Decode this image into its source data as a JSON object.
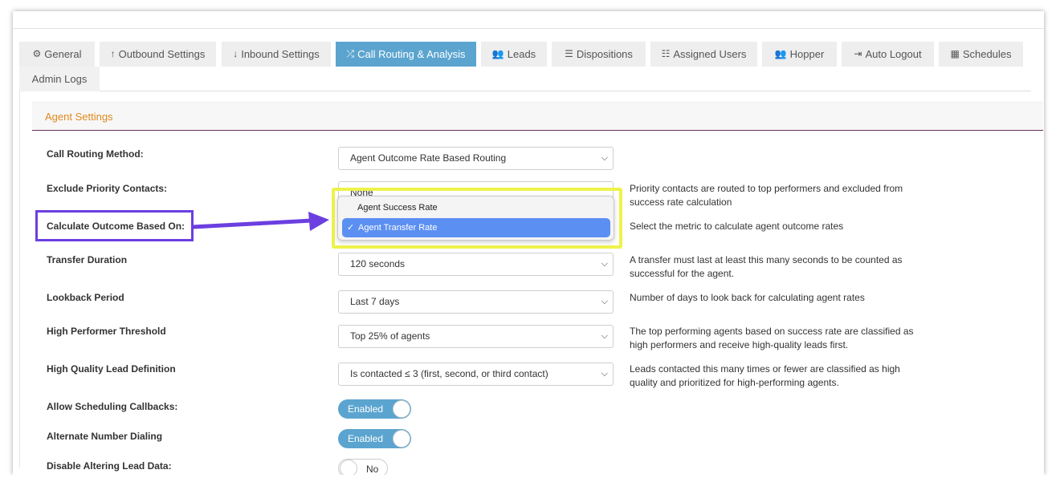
{
  "tabs": [
    {
      "label": "General",
      "icon": "gears-icon"
    },
    {
      "label": "Outbound Settings",
      "icon": "arrow-up-icon"
    },
    {
      "label": "Inbound Settings",
      "icon": "arrow-down-icon"
    },
    {
      "label": "Call Routing & Analysis",
      "icon": "shuffle-icon",
      "active": true
    },
    {
      "label": "Leads",
      "icon": "users-icon"
    },
    {
      "label": "Dispositions",
      "icon": "list-icon"
    },
    {
      "label": "Assigned Users",
      "icon": "ordered-list-icon"
    },
    {
      "label": "Hopper",
      "icon": "users-icon"
    },
    {
      "label": "Auto Logout",
      "icon": "sign-out-icon"
    },
    {
      "label": "Schedules",
      "icon": "calendar-icon"
    },
    {
      "label": "Admin Logs",
      "icon": ""
    }
  ],
  "section": {
    "title": "Agent Settings",
    "accent": "#e08a1e"
  },
  "settings": {
    "call_routing_method": {
      "label": "Call Routing Method:",
      "value": "Agent Outcome Rate Based Routing"
    },
    "exclude_priority": {
      "label": "Exclude Priority Contacts:",
      "value": "None",
      "help": "Priority contacts are routed to top performers and excluded from success rate calculation"
    },
    "calculate_outcome": {
      "label": "Calculate Outcome Based On:",
      "help": "Select the metric to calculate agent outcome rates"
    },
    "transfer_duration": {
      "label": "Transfer Duration",
      "value": "120 seconds",
      "help": "A transfer must last at least this many seconds to be counted as successful for the agent."
    },
    "lookback_period": {
      "label": "Lookback Period",
      "value": "Last 7 days",
      "help": "Number of days to look back for calculating agent rates"
    },
    "high_performer": {
      "label": "High Performer Threshold",
      "value": "Top 25% of agents",
      "help": "The top performing agents based on success rate are classified as high performers and receive high-quality leads first."
    },
    "high_quality_lead": {
      "label": "High Quality Lead Definition",
      "value": "Is contacted ≤ 3 (first, second, or third contact)",
      "help": "Leads contacted this many times or fewer are classified as high quality and prioritized for high-performing agents."
    },
    "allow_callbacks": {
      "label": "Allow Scheduling Callbacks:",
      "value": "Enabled"
    },
    "alternate_dialing": {
      "label": "Alternate Number Dialing",
      "value": "Enabled"
    },
    "disable_altering": {
      "label": "Disable Altering Lead Data:",
      "value": "No"
    }
  },
  "dropdown": {
    "options": [
      "Agent Success Rate",
      "Agent Transfer Rate"
    ],
    "selected": "Agent Transfer Rate"
  },
  "colors": {
    "active_tab": "#5ba4cf",
    "highlight_arrow": "#6b3fe0",
    "highlight_box": "#eef24a",
    "selected_option": "#5b8ff2"
  }
}
